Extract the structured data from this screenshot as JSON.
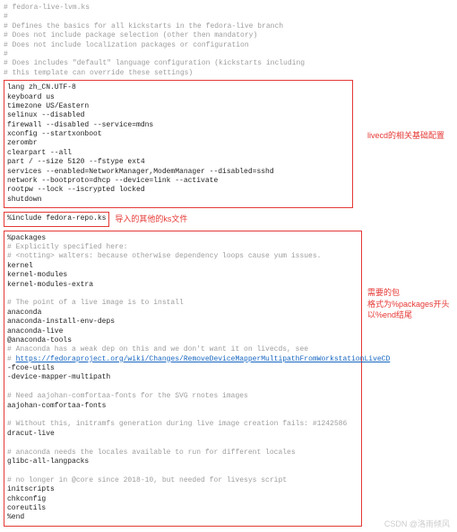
{
  "header": {
    "filename": "# fedora-live-lvm.ks",
    "sep": "#",
    "c1": "# Defines the basics for all kickstarts in the fedora-live branch",
    "c2": "# Does not include package selection (other then mandatory)",
    "c3": "# Does not include localization packages or configuration",
    "c4": "# Does includes \"default\" language configuration (kickstarts including",
    "c5": "# this template can override these settings)"
  },
  "box1": [
    "lang zh_CN.UTF-8",
    "keyboard us",
    "timezone US/Eastern",
    "selinux --disabled",
    "firewall --disabled --service=mdns",
    "xconfig --startxonboot",
    "zerombr",
    "clearpart --all",
    "part / --size 5120 --fstype ext4",
    "services --enabled=NetworkManager,ModemManager --disabled=sshd",
    "network --bootproto=dhcp --device=link --activate",
    "rootpw --lock --iscrypted locked",
    "shutdown"
  ],
  "include_line": "%include fedora-repo.ks",
  "annot_include": "导入的其他的ks文件",
  "annot_box1": "livecd的相关基础配置",
  "annot_box2_l1": "需要的包",
  "annot_box2_l2": "格式为%packages开头",
  "annot_box2_l3": "以%end结尾",
  "box2": {
    "l0": "%packages",
    "l1": "# Explicitly specified here:",
    "l2": "# <notting> walters: because otherwise dependency loops cause yum issues.",
    "l3": "kernel",
    "l4": "kernel-modules",
    "l5": "kernel-modules-extra",
    "l6": "# The point of a live image is to install",
    "l7": "anaconda",
    "l8": "anaconda-install-env-deps",
    "l9": "anaconda-live",
    "l10": "@anaconda-tools",
    "l11": "# Anaconda has a weak dep on this and we don't want it on livecds, see",
    "link": "https://fedoraproject.org/wiki/Changes/RemoveDeviceMapperMultipathFromWorkstationLiveCD",
    "l12pre": "# ",
    "l13": "-fcoe-utils",
    "l14": "-device-mapper-multipath",
    "l15": "# Need aajohan-comfortaa-fonts for the SVG rnotes images",
    "l16": "aajohan-comfortaa-fonts",
    "l17": "# Without this, initramfs generation during live image creation fails: #1242586",
    "l18": "dracut-live",
    "l19": "# anaconda needs the locales available to run for different locales",
    "l20": "glibc-all-langpacks",
    "l21": "# no longer in @core since 2018-10, but needed for livesys script",
    "l22": "initscripts",
    "l23": "chkconfig",
    "l24": "coreutils",
    "l25": "%end"
  },
  "watermark": "CSDN @洛雨倾风"
}
